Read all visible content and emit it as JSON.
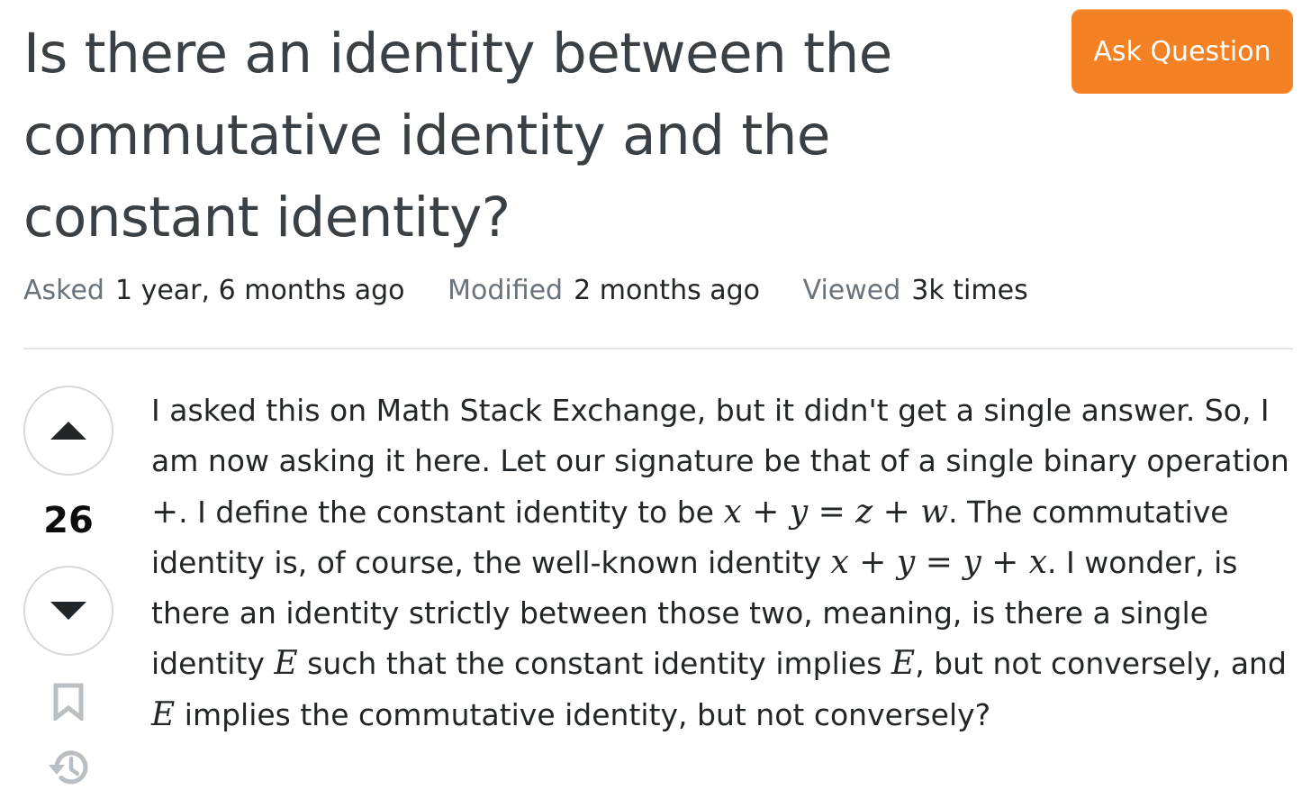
{
  "question": {
    "title": "Is there an identity between the commutative identity and the constant identity?",
    "ask_button_label": "Ask Question",
    "meta": {
      "asked_label": "Asked",
      "asked_value": "1 year, 6 months ago",
      "modified_label": "Modified",
      "modified_value": "2 months ago",
      "viewed_label": "Viewed",
      "viewed_value": "3k times"
    },
    "vote_count": "26",
    "body": {
      "t1": "I asked this on Math Stack Exchange, but it didn't get a single answer. So, I am now asking it here. Let our signature be that of a single binary operation ",
      "m_plus": "+",
      "t2": ". I define the constant identity to be ",
      "m_x1": "x",
      "m_plus1": " + ",
      "m_y1": "y",
      "m_eq1": " = ",
      "m_z1": "z",
      "m_plus2": " + ",
      "m_w1": "w",
      "t3": ". The commutative identity is, of course, the well-known identity ",
      "m_x2": "x",
      "m_plus3": " + ",
      "m_y2": "y",
      "m_eq2": " = ",
      "m_y3": "y",
      "m_plus4": " + ",
      "m_x3": "x",
      "t4": ". I wonder, is there an identity strictly between those two, meaning, is there a single identity ",
      "m_E1": "E",
      "t5": " such that the constant identity implies ",
      "m_E2": "E",
      "t6": ", but not conversely, and ",
      "m_E3": "E",
      "t7": " implies the commutative identity, but not conversely?"
    }
  },
  "icons": {
    "upvote": "triangle-up-icon",
    "downvote": "triangle-down-icon",
    "bookmark": "bookmark-icon",
    "history": "history-icon"
  },
  "colors": {
    "accent": "#f48225",
    "title": "#3b4045",
    "muted": "#6a737c",
    "icon": "#babfc4",
    "border": "#d6d9dc"
  }
}
